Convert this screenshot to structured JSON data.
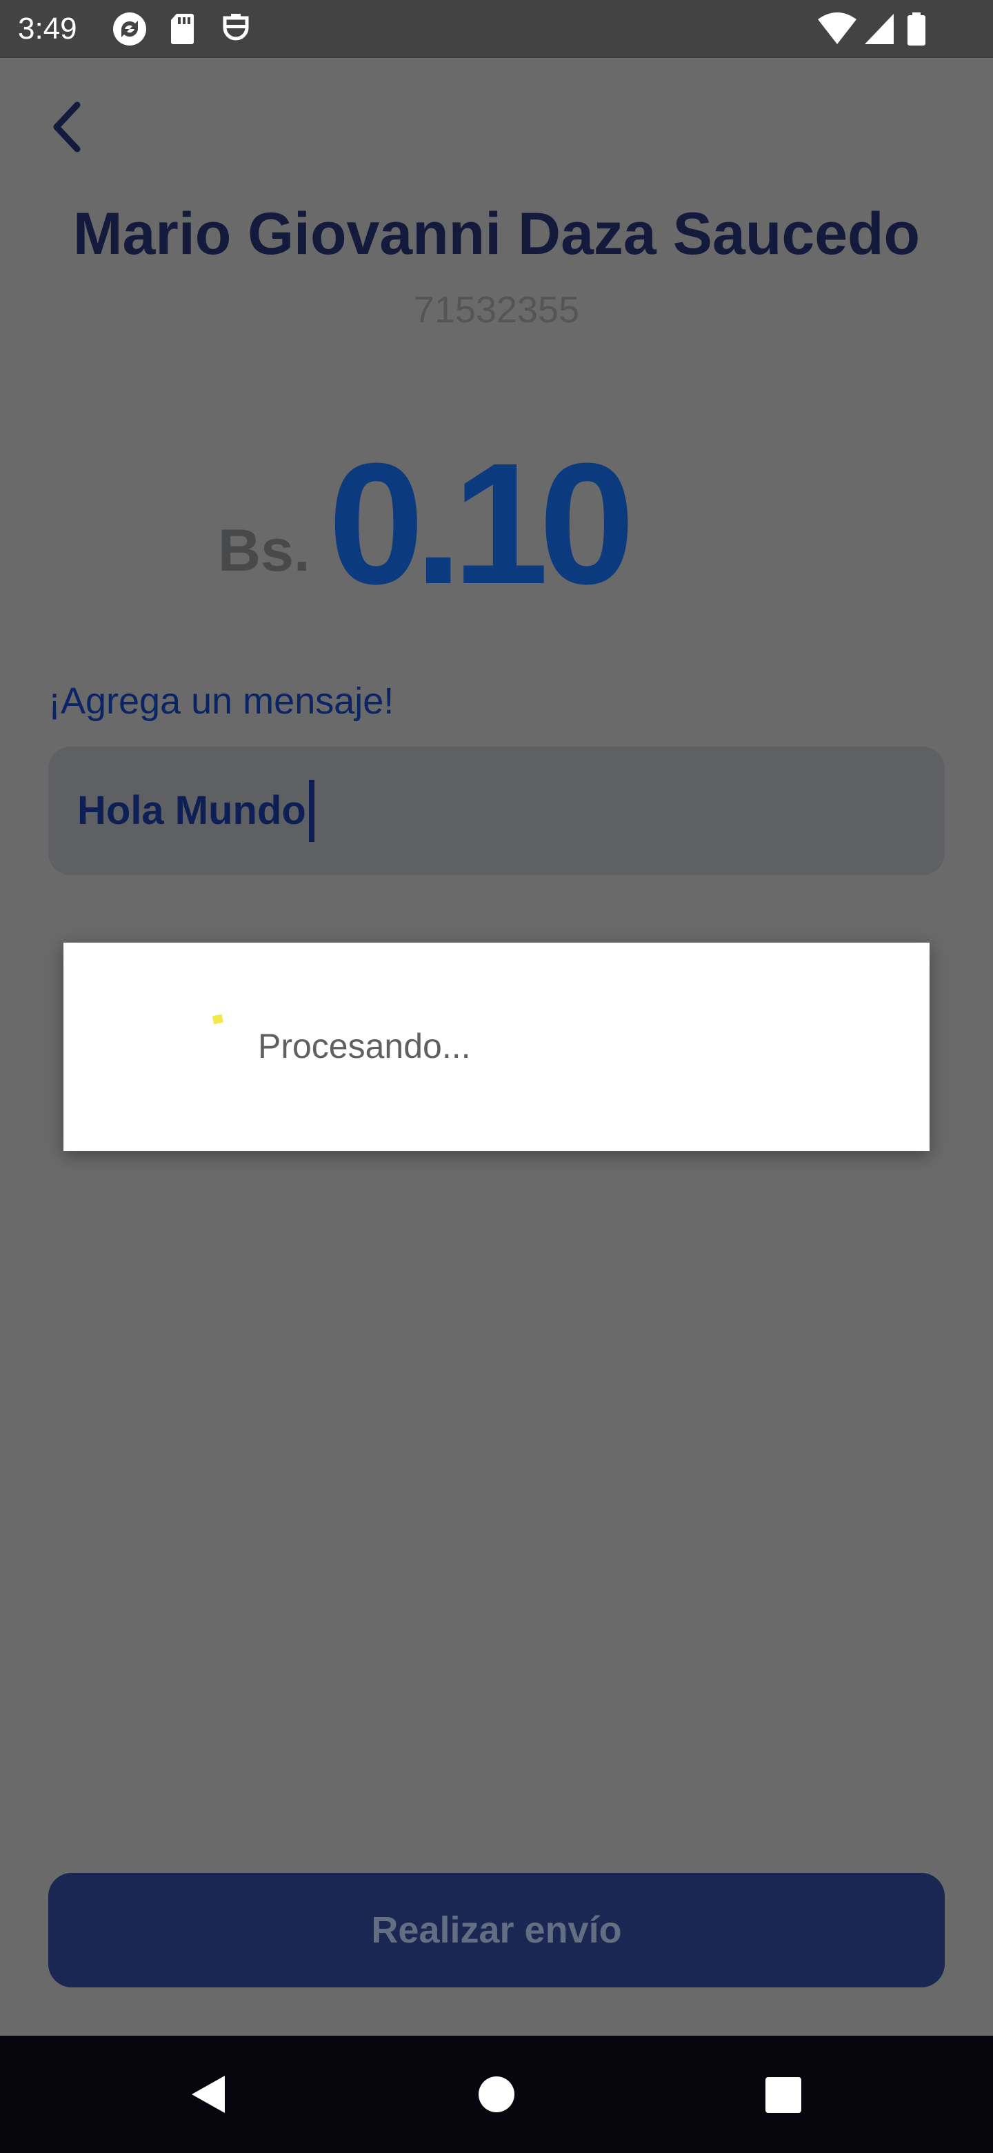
{
  "status_bar": {
    "time": "3:49",
    "left_icons": [
      "sync-icon",
      "sd-card-icon",
      "mask-icon"
    ],
    "right_icons": [
      "wifi-icon",
      "signal-icon",
      "battery-icon"
    ]
  },
  "header": {
    "back_icon": "chevron-left-icon",
    "recipient_name": "Mario Giovanni Daza Saucedo",
    "recipient_phone": "71532355"
  },
  "amount": {
    "currency": "Bs.",
    "value": "0.10",
    "color": "#0c3a7e"
  },
  "message": {
    "label": "¡Agrega un mensaje!",
    "value": "Hola Mundo"
  },
  "submit": {
    "label": "Realizar envío"
  },
  "dialog": {
    "text": "Procesando...",
    "spinner_color": "#f2e84a"
  },
  "nav_bar": {
    "buttons": [
      "back-triangle-icon",
      "home-circle-icon",
      "recents-square-icon"
    ]
  }
}
